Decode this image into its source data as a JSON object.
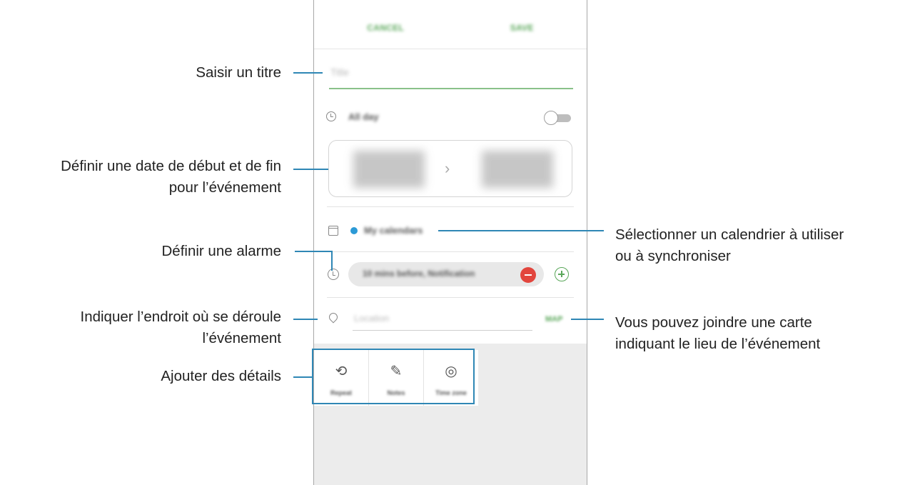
{
  "app": {
    "topbar": {
      "cancel": "CANCEL",
      "save": "SAVE"
    },
    "title_placeholder": "Title",
    "all_day_label": "All day",
    "date_arrow": "›",
    "calendar_label": "My calendars",
    "alarm_value": "10 mins before, Notification",
    "location_placeholder": "Location",
    "map_button": "MAP",
    "options": [
      {
        "label": "Repeat",
        "icon": "repeat-icon",
        "glyph": "⟲"
      },
      {
        "label": "Notes",
        "icon": "notes-icon",
        "glyph": "✎"
      },
      {
        "label": "Time zone",
        "icon": "globe-clock-icon",
        "glyph": "◎"
      }
    ]
  },
  "callouts": {
    "title": "Saisir un titre",
    "date_1": "Définir une date de début et de fin",
    "date_2": "pour l’événement",
    "alarm": "Définir une alarme",
    "location_1": "Indiquer l’endroit où se déroule",
    "location_2": "l’événement",
    "details": "Ajouter des détails",
    "calendar_1": "Sélectionner un calendrier à utiliser",
    "calendar_2": "ou à synchroniser",
    "map_1": "Vous pouvez joindre une carte",
    "map_2": "indiquant le lieu de l’événement"
  },
  "colors": {
    "accent_green": "#5aa75a",
    "callout_blue": "#2f87b5",
    "minus_red": "#e2453d",
    "calendar_dot": "#2c9ad6"
  }
}
